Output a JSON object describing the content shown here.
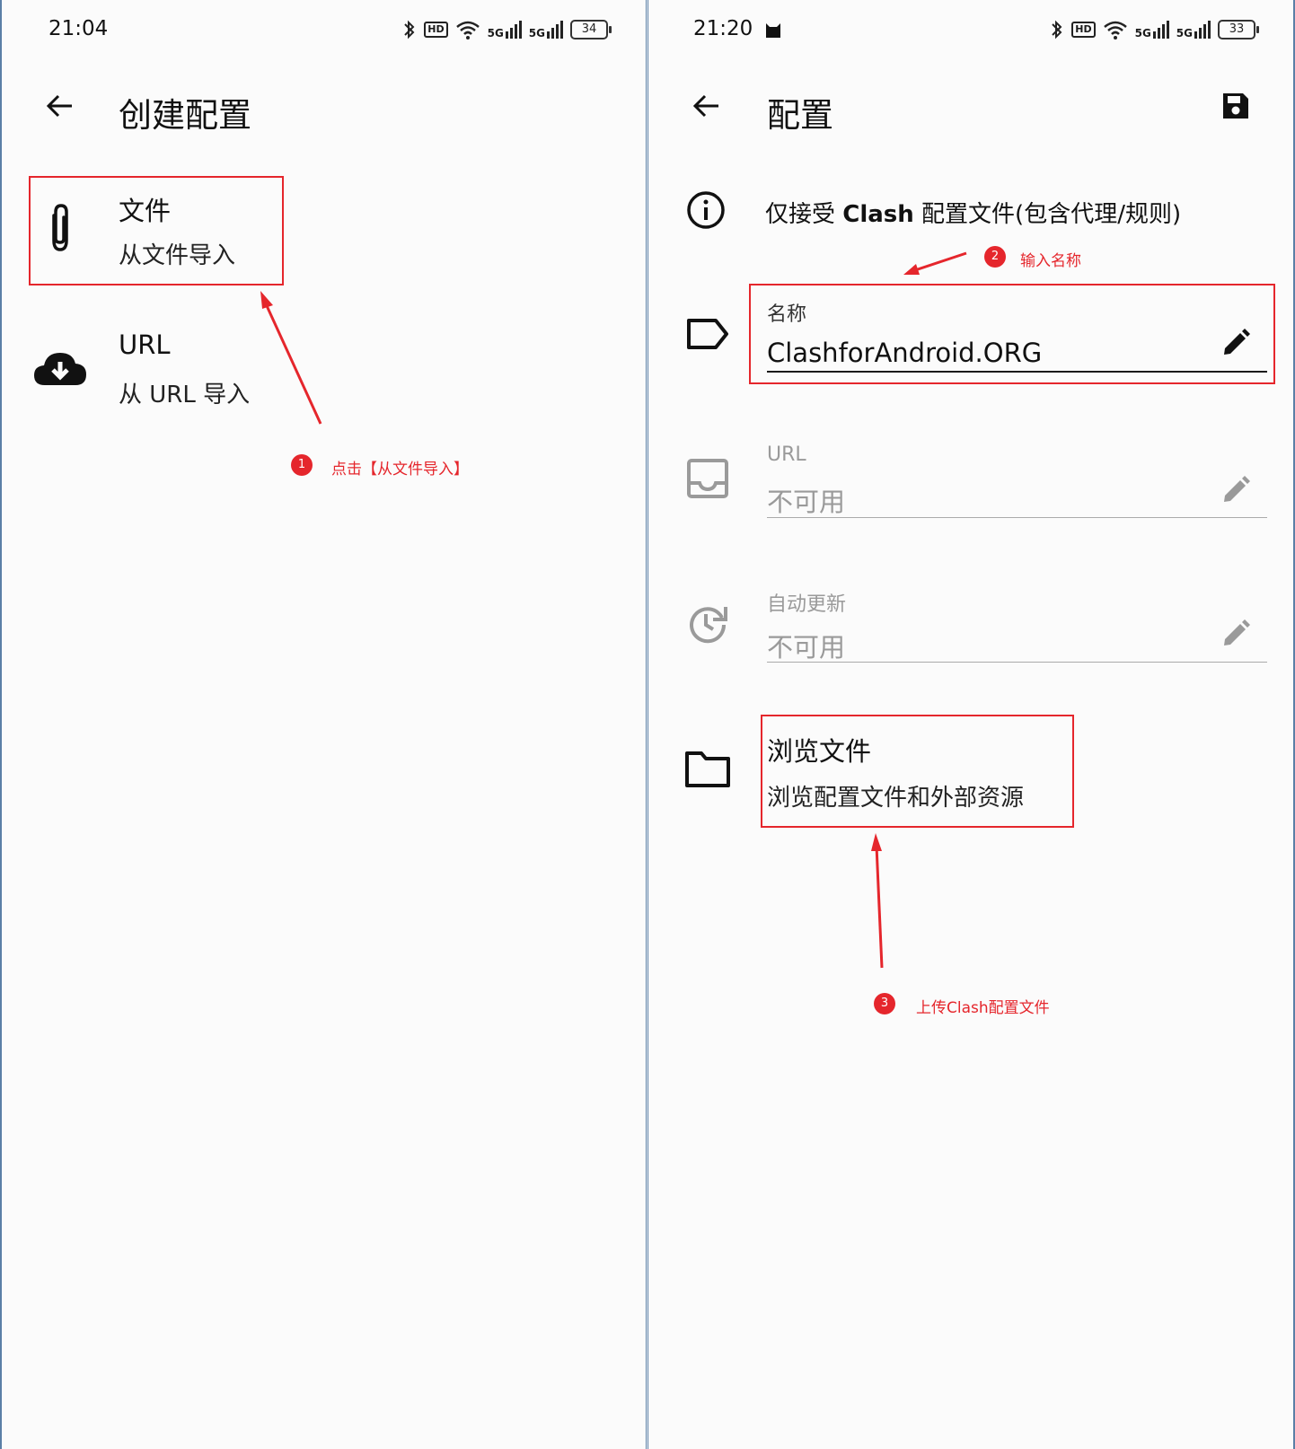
{
  "left": {
    "status": {
      "time": "21:04",
      "battery": "34",
      "hd": "HD",
      "signal": "5G"
    },
    "title": "创建配置",
    "items": [
      {
        "title": "文件",
        "subtitle": "从文件导入",
        "icon": "paperclip-icon"
      },
      {
        "title": "URL",
        "subtitle": "从 URL 导入",
        "icon": "cloud-download-icon"
      }
    ],
    "annotation": {
      "number": "1",
      "text": "点击【从文件导入】"
    }
  },
  "right": {
    "status": {
      "time": "21:20",
      "battery": "33",
      "hd": "HD",
      "signal": "5G"
    },
    "title": "配置",
    "info": {
      "prefix": "仅接受 ",
      "bold": "Clash",
      "suffix": " 配置文件(包含代理/规则)"
    },
    "fields": {
      "name": {
        "label": "名称",
        "value": "ClashforAndroid.ORG"
      },
      "url": {
        "label": "URL",
        "value": "不可用"
      },
      "auto_update": {
        "label": "自动更新",
        "value": "不可用"
      }
    },
    "browse": {
      "title": "浏览文件",
      "subtitle": "浏览配置文件和外部资源"
    },
    "annotations": [
      {
        "number": "2",
        "text": "输入名称"
      },
      {
        "number": "3",
        "text": "上传Clash配置文件"
      }
    ]
  },
  "colors": {
    "annotation_red": "#e5262c",
    "screen_bg": "#fbfbfb",
    "frame_border": "#5b7fa6"
  }
}
